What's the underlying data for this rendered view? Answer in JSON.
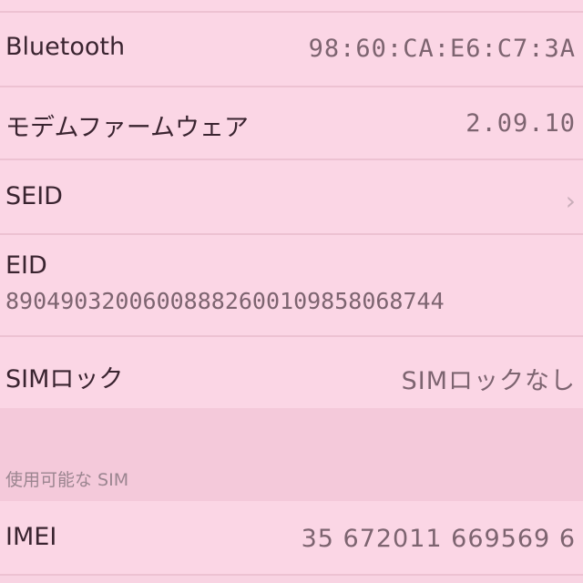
{
  "rows": [
    {
      "label": "Bluetooth",
      "value": "98:60:CA:E6:C7:3A"
    },
    {
      "label": "モデムファームウェア",
      "value": "2.09.10"
    },
    {
      "label": "SEID",
      "chevron": "chevron-right-icon"
    },
    {
      "label": "EID",
      "value": "89049032006008882600109858068744"
    },
    {
      "label": "SIMロック",
      "value": "SIMロックなし"
    }
  ],
  "section_header": "使用可能な SIM",
  "imei": {
    "label": "IMEI",
    "value": "35 672011 669569 6"
  }
}
